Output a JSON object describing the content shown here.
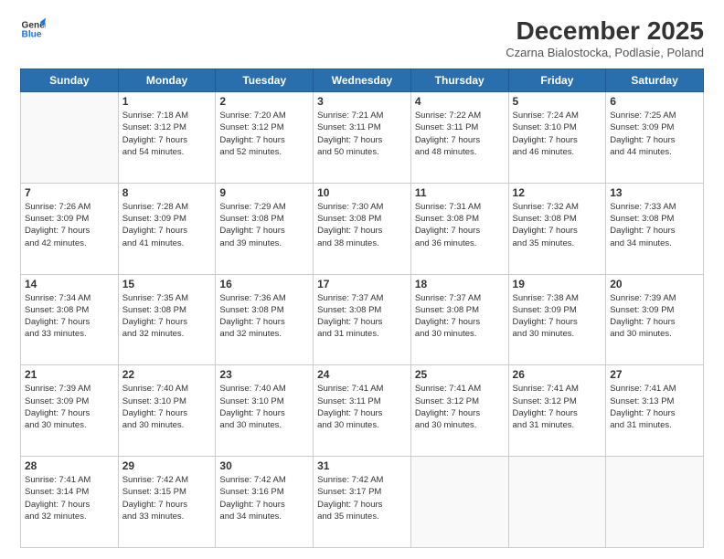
{
  "logo": {
    "line1": "General",
    "line2": "Blue"
  },
  "title": "December 2025",
  "subtitle": "Czarna Bialostocka, Podlasie, Poland",
  "header_days": [
    "Sunday",
    "Monday",
    "Tuesday",
    "Wednesday",
    "Thursday",
    "Friday",
    "Saturday"
  ],
  "weeks": [
    [
      {
        "day": "",
        "info": ""
      },
      {
        "day": "1",
        "info": "Sunrise: 7:18 AM\nSunset: 3:12 PM\nDaylight: 7 hours\nand 54 minutes."
      },
      {
        "day": "2",
        "info": "Sunrise: 7:20 AM\nSunset: 3:12 PM\nDaylight: 7 hours\nand 52 minutes."
      },
      {
        "day": "3",
        "info": "Sunrise: 7:21 AM\nSunset: 3:11 PM\nDaylight: 7 hours\nand 50 minutes."
      },
      {
        "day": "4",
        "info": "Sunrise: 7:22 AM\nSunset: 3:11 PM\nDaylight: 7 hours\nand 48 minutes."
      },
      {
        "day": "5",
        "info": "Sunrise: 7:24 AM\nSunset: 3:10 PM\nDaylight: 7 hours\nand 46 minutes."
      },
      {
        "day": "6",
        "info": "Sunrise: 7:25 AM\nSunset: 3:09 PM\nDaylight: 7 hours\nand 44 minutes."
      }
    ],
    [
      {
        "day": "7",
        "info": "Sunrise: 7:26 AM\nSunset: 3:09 PM\nDaylight: 7 hours\nand 42 minutes."
      },
      {
        "day": "8",
        "info": "Sunrise: 7:28 AM\nSunset: 3:09 PM\nDaylight: 7 hours\nand 41 minutes."
      },
      {
        "day": "9",
        "info": "Sunrise: 7:29 AM\nSunset: 3:08 PM\nDaylight: 7 hours\nand 39 minutes."
      },
      {
        "day": "10",
        "info": "Sunrise: 7:30 AM\nSunset: 3:08 PM\nDaylight: 7 hours\nand 38 minutes."
      },
      {
        "day": "11",
        "info": "Sunrise: 7:31 AM\nSunset: 3:08 PM\nDaylight: 7 hours\nand 36 minutes."
      },
      {
        "day": "12",
        "info": "Sunrise: 7:32 AM\nSunset: 3:08 PM\nDaylight: 7 hours\nand 35 minutes."
      },
      {
        "day": "13",
        "info": "Sunrise: 7:33 AM\nSunset: 3:08 PM\nDaylight: 7 hours\nand 34 minutes."
      }
    ],
    [
      {
        "day": "14",
        "info": "Sunrise: 7:34 AM\nSunset: 3:08 PM\nDaylight: 7 hours\nand 33 minutes."
      },
      {
        "day": "15",
        "info": "Sunrise: 7:35 AM\nSunset: 3:08 PM\nDaylight: 7 hours\nand 32 minutes."
      },
      {
        "day": "16",
        "info": "Sunrise: 7:36 AM\nSunset: 3:08 PM\nDaylight: 7 hours\nand 32 minutes."
      },
      {
        "day": "17",
        "info": "Sunrise: 7:37 AM\nSunset: 3:08 PM\nDaylight: 7 hours\nand 31 minutes."
      },
      {
        "day": "18",
        "info": "Sunrise: 7:37 AM\nSunset: 3:08 PM\nDaylight: 7 hours\nand 30 minutes."
      },
      {
        "day": "19",
        "info": "Sunrise: 7:38 AM\nSunset: 3:09 PM\nDaylight: 7 hours\nand 30 minutes."
      },
      {
        "day": "20",
        "info": "Sunrise: 7:39 AM\nSunset: 3:09 PM\nDaylight: 7 hours\nand 30 minutes."
      }
    ],
    [
      {
        "day": "21",
        "info": "Sunrise: 7:39 AM\nSunset: 3:09 PM\nDaylight: 7 hours\nand 30 minutes."
      },
      {
        "day": "22",
        "info": "Sunrise: 7:40 AM\nSunset: 3:10 PM\nDaylight: 7 hours\nand 30 minutes."
      },
      {
        "day": "23",
        "info": "Sunrise: 7:40 AM\nSunset: 3:10 PM\nDaylight: 7 hours\nand 30 minutes."
      },
      {
        "day": "24",
        "info": "Sunrise: 7:41 AM\nSunset: 3:11 PM\nDaylight: 7 hours\nand 30 minutes."
      },
      {
        "day": "25",
        "info": "Sunrise: 7:41 AM\nSunset: 3:12 PM\nDaylight: 7 hours\nand 30 minutes."
      },
      {
        "day": "26",
        "info": "Sunrise: 7:41 AM\nSunset: 3:12 PM\nDaylight: 7 hours\nand 31 minutes."
      },
      {
        "day": "27",
        "info": "Sunrise: 7:41 AM\nSunset: 3:13 PM\nDaylight: 7 hours\nand 31 minutes."
      }
    ],
    [
      {
        "day": "28",
        "info": "Sunrise: 7:41 AM\nSunset: 3:14 PM\nDaylight: 7 hours\nand 32 minutes."
      },
      {
        "day": "29",
        "info": "Sunrise: 7:42 AM\nSunset: 3:15 PM\nDaylight: 7 hours\nand 33 minutes."
      },
      {
        "day": "30",
        "info": "Sunrise: 7:42 AM\nSunset: 3:16 PM\nDaylight: 7 hours\nand 34 minutes."
      },
      {
        "day": "31",
        "info": "Sunrise: 7:42 AM\nSunset: 3:17 PM\nDaylight: 7 hours\nand 35 minutes."
      },
      {
        "day": "",
        "info": ""
      },
      {
        "day": "",
        "info": ""
      },
      {
        "day": "",
        "info": ""
      }
    ]
  ]
}
